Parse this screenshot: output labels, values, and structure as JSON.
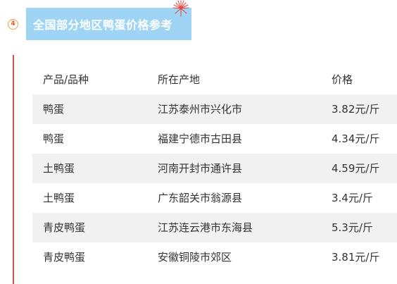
{
  "section": {
    "number": "4",
    "title": "全国部分地区鸭蛋价格参考"
  },
  "table": {
    "headers": [
      "产品/品种",
      "所在产地",
      "价格"
    ],
    "rows": [
      [
        "鸭蛋",
        "江苏泰州市兴化市",
        "3.82元/斤"
      ],
      [
        "鸭蛋",
        "福建宁德市古田县",
        "4.34元/斤"
      ],
      [
        "土鸭蛋",
        "河南开封市通许县",
        "4.59元/斤"
      ],
      [
        "土鸭蛋",
        "广东韶关市翁源县",
        "3.4元/斤"
      ],
      [
        "青皮鸭蛋",
        "江苏连云港市东海县",
        "5.3元/斤"
      ],
      [
        "青皮鸭蛋",
        "安徽铜陵市郊区",
        "3.81元/斤"
      ]
    ]
  },
  "colors": {
    "title_bar": "#9fd4f5",
    "side_line": "#d6504a",
    "shaded_row": "#f1f1f1",
    "badge_ring": "#e8a33b",
    "firework": "#e8433b"
  }
}
